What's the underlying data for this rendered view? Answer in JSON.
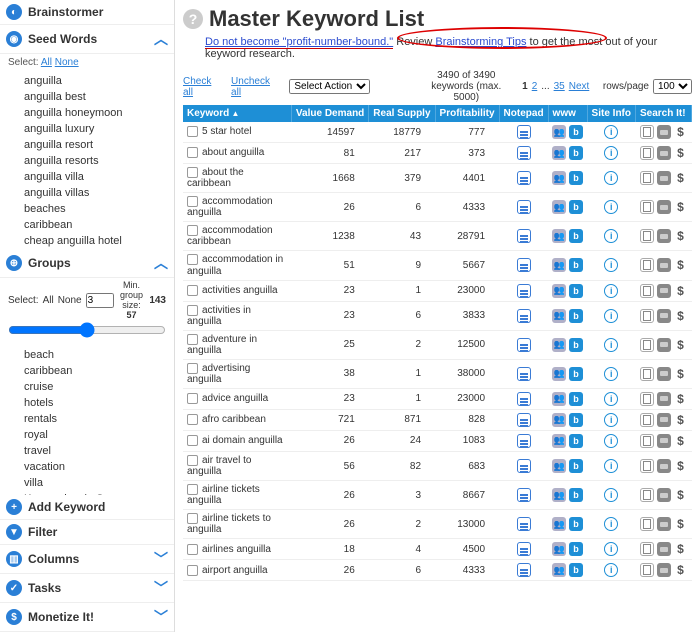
{
  "sidebar": {
    "brainstormer": {
      "label": "Brainstormer"
    },
    "seed": {
      "label": "Seed Words",
      "select_label": "Select:",
      "all": "All",
      "none": "None",
      "items": [
        "anguilla",
        "anguilla best",
        "anguilla honeymoon",
        "anguilla luxury",
        "anguilla resort",
        "anguilla resorts",
        "anguilla villa",
        "anguilla villas",
        "beaches",
        "caribbean",
        "cheap anguilla hotel"
      ]
    },
    "groups": {
      "label": "Groups",
      "select_label": "Select:",
      "all": "All",
      "none": "None",
      "min_label": "Min. group size:",
      "min_low": "3",
      "min_high": "57",
      "max": "143",
      "items": [
        "beach",
        "caribbean",
        "cruise",
        "hotels",
        "rentals",
        "royal",
        "travel",
        "vacation",
        "villa",
        "Keywords w/o Groups"
      ]
    },
    "add": {
      "label": "Add Keyword"
    },
    "filter": {
      "label": "Filter"
    },
    "columns": {
      "label": "Columns"
    },
    "tasks": {
      "label": "Tasks"
    },
    "monetize": {
      "label": "Monetize It!"
    }
  },
  "header": {
    "title": "Master Keyword List",
    "tip_lead": "Do not become \"profit-number-bound.\"",
    "tip_mid": " Review ",
    "tip_link": "Brainstorming Tips",
    "tip_tail": " to get the most out of your keyword research."
  },
  "controls": {
    "check_all": "Check all",
    "uncheck_all": "Uncheck all",
    "action": "Select Action",
    "count_top": "3490 of 3490",
    "count_bot": "keywords (max. 5000)",
    "page_1": "1",
    "page_2": "2",
    "page_dots": "...",
    "page_last": "35",
    "page_next": "Next",
    "rows_label": "rows/page",
    "rows_val": "100"
  },
  "columns": {
    "kw": "Keyword",
    "vd": "Value Demand",
    "rs": "Real Supply",
    "prof": "Profitability",
    "note": "Notepad",
    "www": "www",
    "site": "Site Info",
    "search": "Search It!"
  },
  "rows": [
    {
      "kw": "5 star hotel",
      "vd": "14597",
      "rs": "18779",
      "prof": "777"
    },
    {
      "kw": "about anguilla",
      "vd": "81",
      "rs": "217",
      "prof": "373"
    },
    {
      "kw": "about the caribbean",
      "vd": "1668",
      "rs": "379",
      "prof": "4401"
    },
    {
      "kw": "accommodation anguilla",
      "vd": "26",
      "rs": "6",
      "prof": "4333"
    },
    {
      "kw": "accommodation caribbean",
      "vd": "1238",
      "rs": "43",
      "prof": "28791"
    },
    {
      "kw": "accommodation in anguilla",
      "vd": "51",
      "rs": "9",
      "prof": "5667"
    },
    {
      "kw": "activities anguilla",
      "vd": "23",
      "rs": "1",
      "prof": "23000"
    },
    {
      "kw": "activities in anguilla",
      "vd": "23",
      "rs": "6",
      "prof": "3833"
    },
    {
      "kw": "adventure in anguilla",
      "vd": "25",
      "rs": "2",
      "prof": "12500"
    },
    {
      "kw": "advertising anguilla",
      "vd": "38",
      "rs": "1",
      "prof": "38000"
    },
    {
      "kw": "advice anguilla",
      "vd": "23",
      "rs": "1",
      "prof": "23000"
    },
    {
      "kw": "afro caribbean",
      "vd": "721",
      "rs": "871",
      "prof": "828"
    },
    {
      "kw": "ai domain anguilla",
      "vd": "26",
      "rs": "24",
      "prof": "1083"
    },
    {
      "kw": "air travel to anguilla",
      "vd": "56",
      "rs": "82",
      "prof": "683"
    },
    {
      "kw": "airline tickets anguilla",
      "vd": "26",
      "rs": "3",
      "prof": "8667"
    },
    {
      "kw": "airline tickets to anguilla",
      "vd": "26",
      "rs": "2",
      "prof": "13000"
    },
    {
      "kw": "airlines anguilla",
      "vd": "18",
      "rs": "4",
      "prof": "4500"
    },
    {
      "kw": "airport anguilla",
      "vd": "26",
      "rs": "6",
      "prof": "4333"
    }
  ]
}
